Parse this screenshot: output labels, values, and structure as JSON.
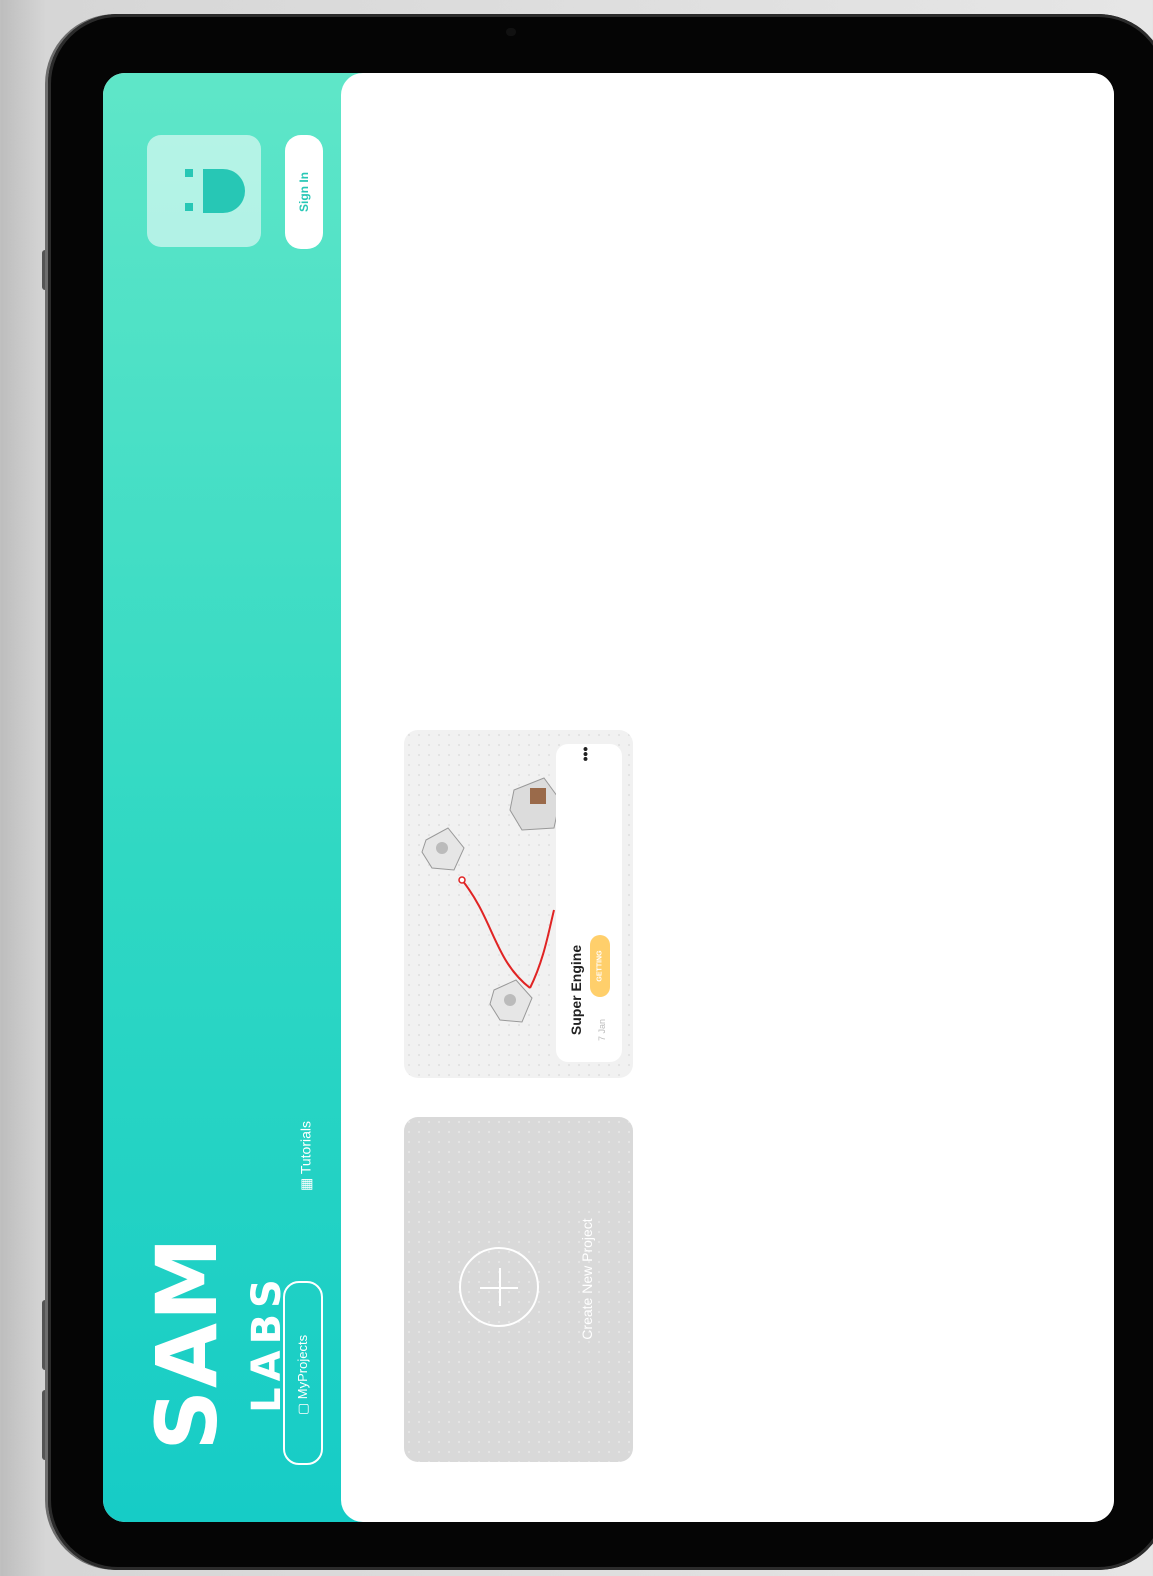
{
  "sidebar": {
    "sign_in_label": "Sign In",
    "logo_top": "SAM",
    "logo_bottom": "LABS",
    "nav": {
      "my_projects_label": "MyProjects",
      "tutorials_label": "Tutorials"
    }
  },
  "projects": {
    "create_label": "Create New Project",
    "items": [
      {
        "title": "Super Engine",
        "date": "7 Jan",
        "tag": "GETTING",
        "menu": "•••"
      }
    ]
  },
  "colors": {
    "accent_top": "#5fe6c8",
    "accent_bottom": "#16ccc6",
    "tag": "#ffcf6b",
    "wire": "#e02424"
  }
}
